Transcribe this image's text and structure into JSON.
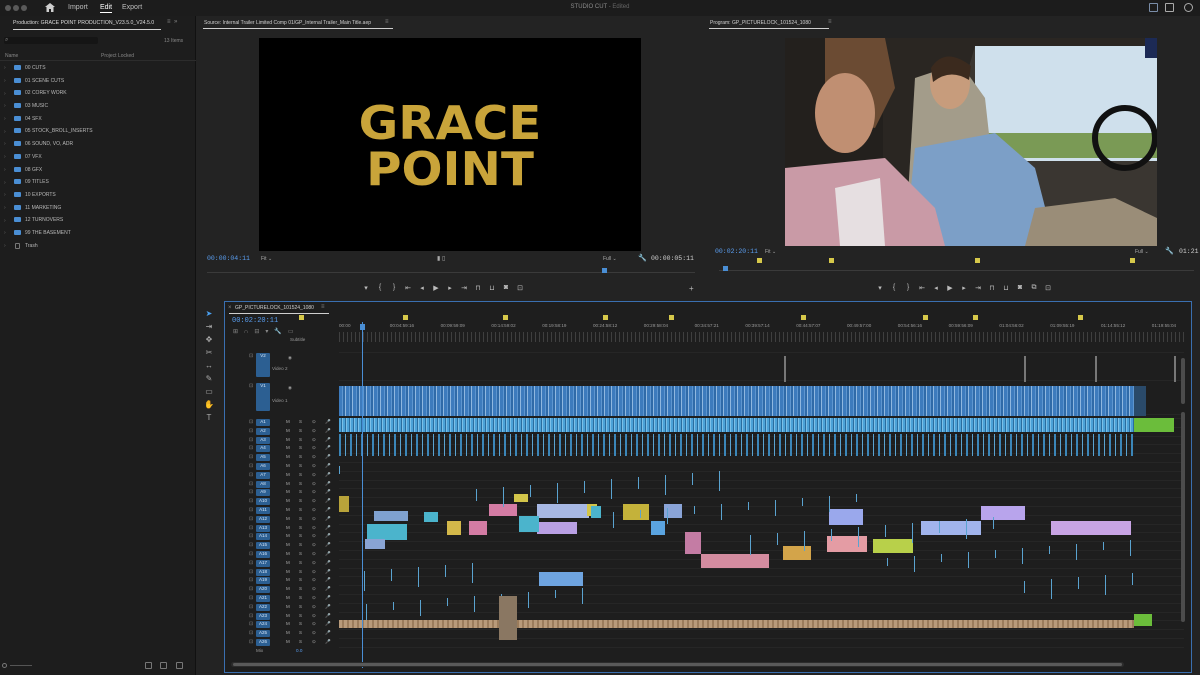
{
  "app": {
    "title": "STUDIO CUT",
    "edited": "- Edited",
    "nav": [
      "Import",
      "Edit",
      "Export"
    ],
    "active_nav": "Edit"
  },
  "project": {
    "tab_label": "Production: GRACE POINT PRODUCTION_V23.5.0_V24.5.0",
    "item_count": "13 Items",
    "col_name": "Name",
    "col_status": "Project Locked",
    "bins": [
      "00 CUTS",
      "01 SCENE CUTS",
      "02 COREY WORK",
      "03 MUSIC",
      "04 SFX",
      "05 STOCK_BROLL_INSERTS",
      "06 SOUND, VO, ADR",
      "07 VFX",
      "08 GFX",
      "09 TITLES",
      "10 EXPORTS",
      "11 MARKETING",
      "12 TURNOVERS",
      "99 THE BASEMENT",
      "Trash"
    ]
  },
  "source": {
    "title": "Source: Internal Trailer Limited Comp 01/GP_Internal Trailer_Main Title.aep",
    "logo_line1": "GRACE",
    "logo_line2": "POINT",
    "timecode": "00:00:04:11",
    "fit": "Fit",
    "quality": "Full",
    "duration": "00:00:05:11"
  },
  "program": {
    "title": "Program: GP_PICTURELOCK_101524_1080",
    "timecode": "00:02:20:11",
    "fit": "Fit",
    "quality": "Full",
    "duration": "01:21"
  },
  "timeline": {
    "tab_label": "GP_PICTURELOCK_101524_1080",
    "timecode": "00:02:20:11",
    "ruler": [
      "00:00",
      "00:04:59:16",
      "00:09:59:09",
      "00:14:59:02",
      "00:19:58:19",
      "00:24:58:12",
      "00:29:58:04",
      "00:34:57:21",
      "00:39:57:14",
      "00:44:57:07",
      "00:49:57:00",
      "00:54:56:16",
      "00:59:56:09",
      "01:04:56:02",
      "01:09:55:19",
      "01:14:55:12",
      "01:19:55:04"
    ],
    "subtitle_label": "Subtitle",
    "video_tracks": [
      {
        "id": "V2",
        "name": "Video 2"
      },
      {
        "id": "V1",
        "name": "Video 1"
      }
    ],
    "audio_tracks": [
      "A1",
      "A2",
      "A3",
      "A4",
      "A5",
      "A6",
      "A7",
      "A8",
      "A9",
      "A10",
      "A11",
      "A12",
      "A13",
      "A14",
      "A15",
      "A16",
      "A17",
      "A18",
      "A19",
      "A20",
      "A21",
      "A22",
      "A23",
      "A24",
      "A25",
      "A26"
    ],
    "mix_label": "Mix",
    "mix_value": "0.0"
  },
  "colors": {
    "accent": "#4a8ed4",
    "video_clip": "#3f7fc4",
    "audio_clip": "#4ba2d8",
    "music": "#7ac143",
    "marker": "#d6c84a"
  }
}
